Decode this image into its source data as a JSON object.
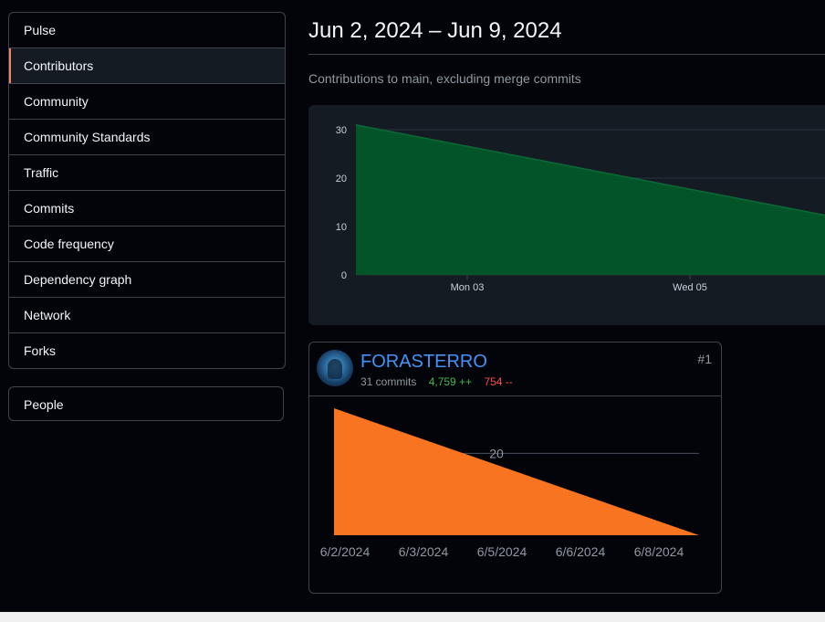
{
  "sidebar": {
    "items": [
      {
        "label": "Pulse",
        "selected": false
      },
      {
        "label": "Contributors",
        "selected": true
      },
      {
        "label": "Community",
        "selected": false
      },
      {
        "label": "Community Standards",
        "selected": false
      },
      {
        "label": "Traffic",
        "selected": false
      },
      {
        "label": "Commits",
        "selected": false
      },
      {
        "label": "Code frequency",
        "selected": false
      },
      {
        "label": "Dependency graph",
        "selected": false
      },
      {
        "label": "Network",
        "selected": false
      },
      {
        "label": "Forks",
        "selected": false
      }
    ],
    "people_label": "People",
    "accent_color": "#f78166"
  },
  "header": {
    "date_range": "Jun 2, 2024 – Jun 9, 2024",
    "subtitle": "Contributions to main, excluding merge commits"
  },
  "contributor": {
    "login": "FORASTERRO",
    "commits": "31 commits",
    "additions": "4,759 ++",
    "deletions": "754 --",
    "rank": "#1",
    "avatar_icon": "user-avatar"
  },
  "colors": {
    "overview_fill": "#04542a",
    "overview_stroke": "#0b6b35",
    "contributor_fill": "#f97420",
    "additions": "#3fb950",
    "deletions": "#f85149",
    "link": "#4493f8"
  },
  "chart_data": [
    {
      "type": "area",
      "name": "overview",
      "x": [
        "2024-06-02",
        "2024-06-09"
      ],
      "values": [
        31,
        0
      ],
      "xtick_labels": [
        "Mon 03",
        "Wed 05"
      ],
      "xtick_dates": [
        "2024-06-03",
        "2024-06-05"
      ],
      "ytick_labels": [
        "0",
        "10",
        "20",
        "30"
      ],
      "ylim": [
        0,
        30
      ],
      "grid": true
    },
    {
      "type": "area",
      "name": "contributor",
      "x": [
        "2024-06-02",
        "2024-06-09"
      ],
      "values": [
        31,
        0
      ],
      "xtick_labels": [
        "6/2/2024",
        "6/3/2024",
        "6/5/2024",
        "6/6/2024",
        "6/8/2024"
      ],
      "ytick_labels": [
        "20"
      ],
      "ylim": [
        0,
        31
      ],
      "grid": true
    }
  ]
}
